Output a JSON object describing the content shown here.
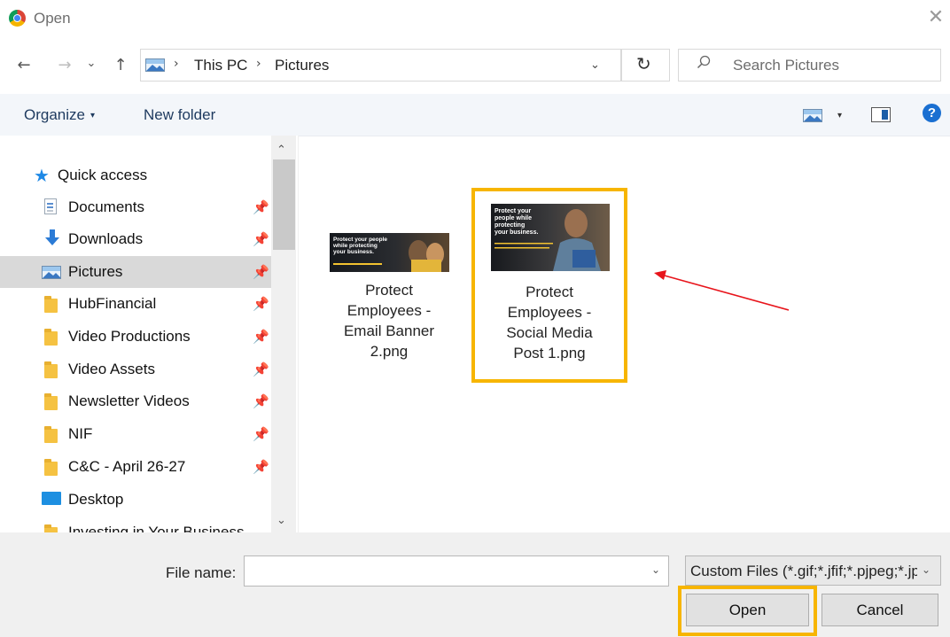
{
  "window": {
    "title": "Open",
    "close_glyph": "✕",
    "app_icon": "chrome-icon"
  },
  "address": {
    "back_glyph": "←",
    "forward_glyph": "→",
    "recent_glyph": "⌄",
    "up_glyph": "↑",
    "separator_glyph": "›",
    "breadcrumbs": [
      "This PC",
      "Pictures"
    ],
    "dropdown_glyph": "⌄",
    "refresh_glyph": "↻",
    "search_placeholder": "Search Pictures"
  },
  "toolbar": {
    "organize_label": "Organize",
    "organize_caret": "▾",
    "new_folder_label": "New folder",
    "view_caret": "▾",
    "help_glyph": "?"
  },
  "sidebar": {
    "pin_glyph": "📌",
    "scroll_up_glyph": "⌃",
    "scroll_down_glyph": "⌄",
    "items": [
      {
        "label": "Quick access",
        "icon": "star-icon",
        "pinned": false
      },
      {
        "label": "Documents",
        "icon": "document-icon",
        "pinned": true
      },
      {
        "label": "Downloads",
        "icon": "download-icon",
        "pinned": true
      },
      {
        "label": "Pictures",
        "icon": "pictures-icon",
        "pinned": true,
        "selected": true
      },
      {
        "label": "HubFinancial",
        "icon": "folder-icon",
        "pinned": true
      },
      {
        "label": "Video Productions",
        "icon": "folder-icon",
        "pinned": true
      },
      {
        "label": "Video Assets",
        "icon": "folder-icon",
        "pinned": true
      },
      {
        "label": "Newsletter Videos",
        "icon": "folder-icon",
        "pinned": true
      },
      {
        "label": "NIF",
        "icon": "folder-icon",
        "pinned": true
      },
      {
        "label": "C&C - April 26-27",
        "icon": "folder-icon",
        "pinned": true
      },
      {
        "label": "Desktop",
        "icon": "desktop-icon",
        "pinned": false
      },
      {
        "label": "Investing in Your Business",
        "icon": "folder-icon",
        "pinned": false
      }
    ]
  },
  "files": [
    {
      "name_lines": [
        "Protect",
        "Employees -",
        "Email Banner",
        "2.png"
      ],
      "thumb_text": [
        "Protect your people",
        "while protecting",
        "your business."
      ]
    },
    {
      "name_lines": [
        "Protect",
        "Employees -",
        "Social Media",
        "Post 1.png"
      ],
      "thumb_text": [
        "Protect your",
        "people while",
        "protecting",
        "your business."
      ],
      "highlighted": true
    }
  ],
  "bottom": {
    "file_name_label": "File name:",
    "file_name_value": "",
    "file_name_dropdown_glyph": "⌄",
    "filter_value": "Custom Files (*.gif;*.jfif;*.pjpeg;*.jpeg;*.pjp;*.png)",
    "filter_dropdown_glyph": "⌄",
    "open_label": "Open",
    "cancel_label": "Cancel"
  },
  "colors": {
    "highlight": "#f7b500",
    "annotation_arrow": "#e8141b",
    "accent": "#1a6fd1"
  }
}
